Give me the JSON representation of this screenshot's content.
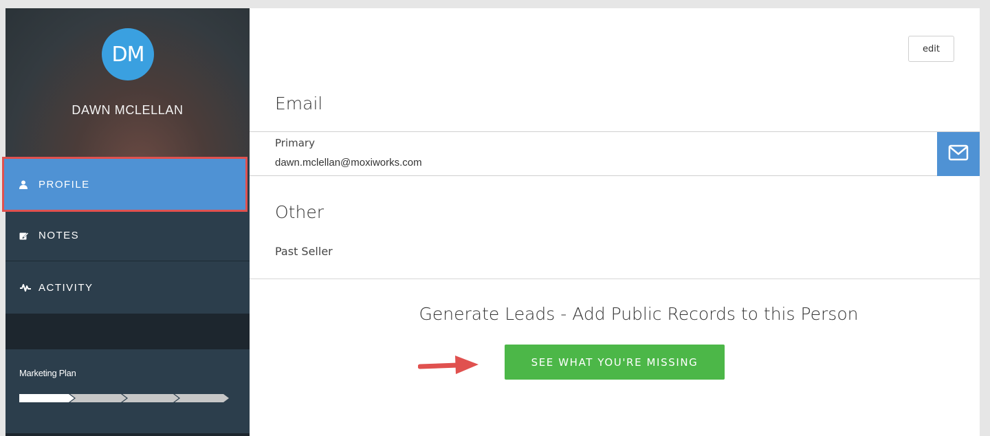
{
  "sidebar": {
    "avatar_initials": "DM",
    "user_name": "DAWN MCLELLAN",
    "nav": {
      "profile": "PROFILE",
      "notes": "NOTES",
      "activity": "ACTIVITY"
    },
    "marketing_plan_label": "Marketing Plan",
    "marketing_plan_progress": {
      "completed_steps": 1,
      "total_steps": 4
    }
  },
  "main": {
    "edit_label": "edit",
    "email_title": "Email",
    "email_type": "Primary",
    "email_address": "dawn.mclellan@moxiworks.com",
    "other_title": "Other",
    "other_value": "Past Seller",
    "leads_title": "Generate Leads - Add Public Records to this Person",
    "cta_label": "SEE WHAT YOU'RE MISSING"
  },
  "colors": {
    "accent_blue": "#4f92d4",
    "avatar_blue": "#3aa0e0",
    "cta_green": "#4cb748",
    "highlight_red": "#e0514f",
    "sidebar_bg": "#2c3e4c"
  },
  "icons": [
    "user-icon",
    "notes-edit-icon",
    "activity-pulse-icon",
    "mail-icon",
    "annotation-arrow-icon"
  ]
}
